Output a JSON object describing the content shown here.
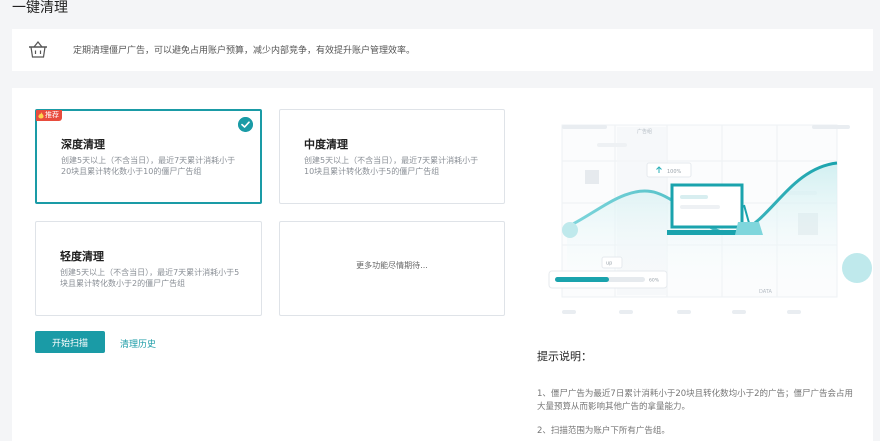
{
  "page_title": "一键清理",
  "notice": {
    "icon": "basket-icon",
    "text": "定期清理僵尸广告，可以避免占用账户预算，减少内部竞争，有效提升账户管理效率。"
  },
  "cards": [
    {
      "title": "深度清理",
      "desc": "创建5天以上（不含当日），最近7天累计消耗小于20块且累计转化数小于10的僵尸广告组",
      "badge": "推荐",
      "selected": true
    },
    {
      "title": "中度清理",
      "desc": "创建5天以上（不含当日），最近7天累计消耗小于10块且累计转化数小于5的僵尸广告组"
    },
    {
      "title": "轻度清理",
      "desc": "创建5天以上（不含当日），最近7天累计消耗小于5块且累计转化数小于2的僵尸广告组"
    },
    {
      "more": "更多功能尽情期待..."
    }
  ],
  "actions": {
    "scan_label": "开始扫描",
    "history_label": "清理历史"
  },
  "illustration": {
    "label_top": "广告组",
    "label_up_pct": "100%",
    "label_up": "up",
    "label_progress": "60%",
    "progress": 0.6,
    "label_data": "DATA"
  },
  "tips": {
    "title": "提示说明：",
    "items": [
      "1、僵尸广告为最近7日累计消耗小于20块且转化数均小于2的广告；僵尸广告会占用大量预算从而影响其他广告的拿量能力。",
      "2、扫描范围为账户下所有广告组。"
    ]
  },
  "colors": {
    "accent": "#1a9ba6",
    "badge": "#e84c3d"
  }
}
